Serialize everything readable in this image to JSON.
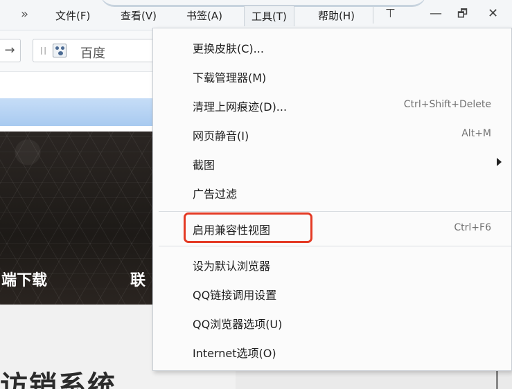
{
  "menubar": {
    "overflow_label": "»",
    "items": [
      {
        "label": "文件(F)"
      },
      {
        "label": "查看(V)"
      },
      {
        "label": "书签(A)"
      },
      {
        "label": "工具(T)"
      },
      {
        "label": "帮助(H)"
      }
    ],
    "pin_glyph": "⊤",
    "minimize_glyph": "—",
    "restore_glyph": "🗗",
    "close_glyph": "✕"
  },
  "toolbar": {
    "forward_glyph": "→",
    "search_engine": "百度"
  },
  "page": {
    "banner_text_left": "端下载",
    "banner_text_right": "联",
    "bottom_title": "访销系统"
  },
  "tools_menu": {
    "items": [
      {
        "label": "更换皮肤(C)...",
        "shortcut": ""
      },
      {
        "label": "下载管理器(M)",
        "shortcut": ""
      },
      {
        "label": "清理上网痕迹(D)...",
        "shortcut": "Ctrl+Shift+Delete"
      },
      {
        "label": "网页静音(I)",
        "shortcut": "Alt+M"
      },
      {
        "label": "截图",
        "shortcut": ""
      },
      {
        "label": "广告过滤",
        "shortcut": ""
      },
      {
        "label": "启用兼容性视图",
        "shortcut": "Ctrl+F6",
        "highlighted": true
      },
      {
        "label": "设为默认浏览器",
        "shortcut": ""
      },
      {
        "label": "QQ链接调用设置",
        "shortcut": ""
      },
      {
        "label": "QQ浏览器选项(U)",
        "shortcut": ""
      },
      {
        "label": "Internet选项(O)",
        "shortcut": ""
      }
    ]
  },
  "colors": {
    "highlight_border": "#e43a24",
    "menubar_bg": "#f4f6f8",
    "blue_strip": "#b3d1f3"
  }
}
